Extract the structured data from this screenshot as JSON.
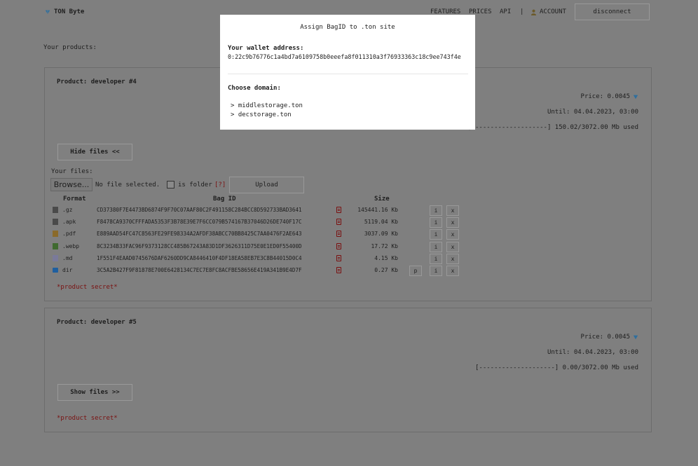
{
  "header": {
    "logo_text": "TON Byte",
    "nav": [
      "FEATURES",
      "PRICES",
      "API",
      "|",
      "ACCOUNT"
    ],
    "disconnect_label": "disconnect"
  },
  "products_label": "Your products:",
  "products": [
    {
      "title": "Product: developer #4",
      "price": "Price: 0.0045",
      "until": "Until: 04.04.2023, 03:00",
      "usage": "[#-------------------] 150.02/3072.00 Mb used",
      "toggle_label": "Hide files <<",
      "files_label": "Your files:",
      "browse_label": "Browse...",
      "no_file_label": "No file selected.",
      "is_folder_label": "is folder",
      "help_label": "[?]",
      "upload_label": "Upload",
      "columns": {
        "format": "Format",
        "bag_id": "Bag ID",
        "size": "Size"
      },
      "files": [
        {
          "format": ".gz",
          "icon": "archive-file-icon",
          "bag_id": "CD37380F7E4473BD6874F9F70C07AAF80C2F491158C284BCC8D592733BAD3641",
          "size": "145441.16 Kb",
          "has_p": false
        },
        {
          "format": ".apk",
          "icon": "archive-file-icon",
          "bag_id": "F8478CA9370CFFFADA5353F3B78E39E7F6CC079B574167B37046D26DE740F17C",
          "size": "5119.04 Kb",
          "has_p": false
        },
        {
          "format": ".pdf",
          "icon": "document-file-icon",
          "bag_id": "E889AAD54FC47C8563FE29FE98334A2AFDF38ABCC70BB8425C7AA0476F2AE643",
          "size": "3037.09 Kb",
          "has_p": false
        },
        {
          "format": ".webp",
          "icon": "image-file-icon",
          "bag_id": "8C3234B33FAC96F9373128CC485B67243A83D1DF3626311D75E0E1ED0F55400D",
          "size": "17.72 Kb",
          "has_p": false
        },
        {
          "format": ".md",
          "icon": "text-file-icon",
          "bag_id": "1F551F4EAAD0745676DAF6260DD9CA8446410F4DF18EA58EB7E3C8B44015D0C4",
          "size": "4.15 Kb",
          "has_p": false
        },
        {
          "format": "dir",
          "icon": "folder-icon",
          "bag_id": "3C5A2B427F9F81878E700E6428134C7EC7E8FC8ACFBE58656E419A341B9E4D7F",
          "size": "0.27 Kb",
          "has_p": true
        }
      ],
      "row_buttons": {
        "p": "p",
        "i": "i",
        "x": "x"
      },
      "secret_label": "*product secret*"
    },
    {
      "title": "Product: developer #5",
      "price": "Price: 0.0045",
      "until": "Until: 04.04.2023, 03:00",
      "usage": "[--------------------] 0.00/3072.00 Mb used",
      "toggle_label": "Show files >>",
      "secret_label": "*product secret*"
    }
  ],
  "modal": {
    "title": "Assign BagID to .ton site",
    "wallet_label": "Your wallet address:",
    "wallet_address": "0:22c9b76776c1a4bd7a6109758b0eeefa8f011310a3f76933363c18c9ee743f4e",
    "domain_label": "Choose domain:",
    "domains": [
      "> middlestorage.ton",
      "> decstorage.ton"
    ]
  },
  "colors": {
    "overlay_bg": "#7f7f7f",
    "modal_bg": "#ffffff",
    "secret": "#7a1010",
    "ton_diamond": "#3a8fd6"
  }
}
